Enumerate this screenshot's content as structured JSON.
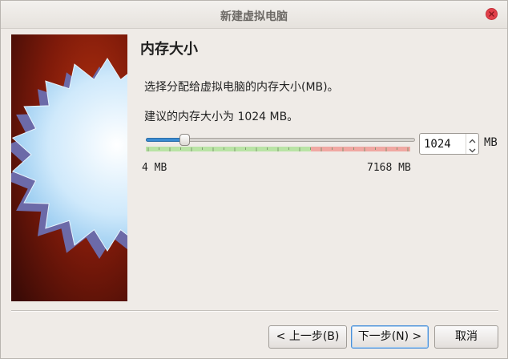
{
  "window": {
    "title": "新建虚拟电脑"
  },
  "page": {
    "heading": "内存大小",
    "description": "选择分配给虚拟电脑的内存大小(MB)。",
    "recommendation": "建议的内存大小为 1024 MB。"
  },
  "memory": {
    "value": "1024",
    "unit": "MB",
    "min_label": "4 MB",
    "max_label": "7168 MB",
    "slider_fraction": 0.142
  },
  "buttons": {
    "back": "< 上一步(B)",
    "next": "下一步(N) >",
    "cancel": "取消"
  },
  "icons": {
    "close": "close-icon",
    "banner": "virtualbox-starburst-banner"
  },
  "colors": {
    "close": "#e2404a",
    "slider_fill": "#3a8bd1",
    "scale_green": "#b9e3a5",
    "scale_red": "#f0a8a2",
    "banner_bg": "#8a1c0c"
  }
}
